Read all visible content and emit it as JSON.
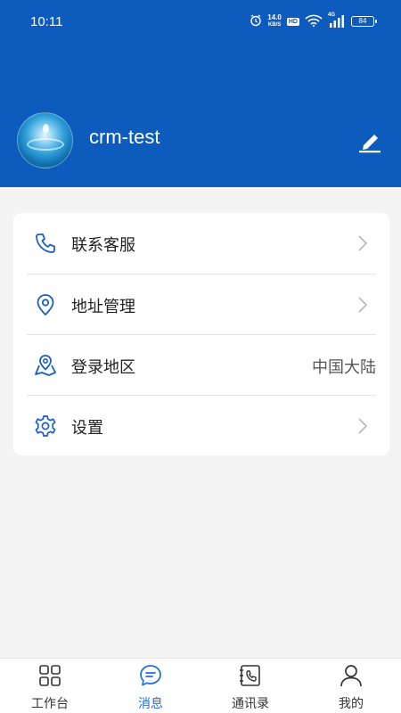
{
  "status_bar": {
    "time": "10:11",
    "net_speed_value": "14.0",
    "net_speed_unit": "KB/S",
    "hd": "HD",
    "signal_tag": "4G",
    "battery": "84"
  },
  "profile": {
    "username": "crm-test"
  },
  "menu": {
    "items": [
      {
        "label": "联系客服",
        "icon": "phone-icon",
        "has_chevron": true
      },
      {
        "label": "地址管理",
        "icon": "location-pin-icon",
        "has_chevron": true
      },
      {
        "label": "登录地区",
        "icon": "map-pin-icon",
        "value": "中国大陆"
      },
      {
        "label": "设置",
        "icon": "gear-icon",
        "has_chevron": true
      }
    ]
  },
  "tabbar": {
    "tabs": [
      {
        "label": "工作台",
        "icon": "grid-icon"
      },
      {
        "label": "消息",
        "icon": "chat-icon",
        "active": true
      },
      {
        "label": "通讯录",
        "icon": "contacts-icon"
      },
      {
        "label": "我的",
        "icon": "user-icon"
      }
    ]
  },
  "colors": {
    "header_bg": "#0d5bbd",
    "accent": "#1c6fd6",
    "page_bg": "#f4f4f4"
  }
}
